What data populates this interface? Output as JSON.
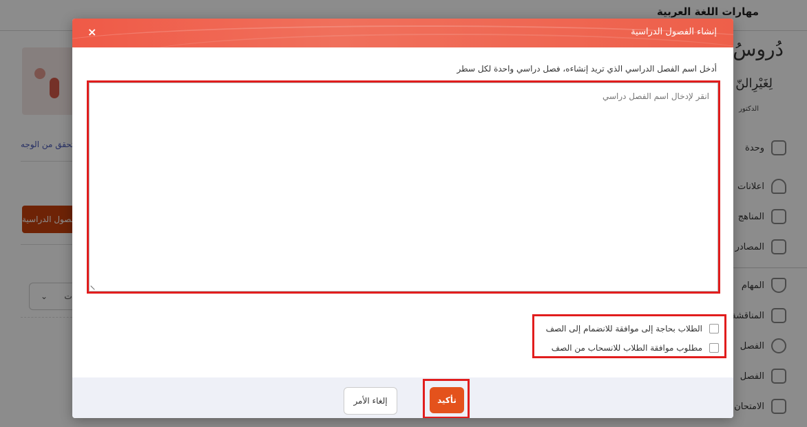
{
  "background": {
    "course_title": "مهارات اللغة العربية",
    "logo_script": "دُروسُ اللُّ",
    "logo_sub": "لِغَيْرِالنّ",
    "logo_author": "الدكتور",
    "sidebar": [
      {
        "label": "وحدة",
        "icon": "list-icon"
      },
      {
        "label": "اعلانات",
        "icon": "bell-icon"
      },
      {
        "label": "المناهج",
        "icon": "book-icon"
      },
      {
        "label": "المصادر",
        "icon": "database-icon"
      },
      {
        "label": "المهام",
        "icon": "shield-icon"
      },
      {
        "label": "المناقشة",
        "icon": "chat-icon"
      },
      {
        "label": "الفصل",
        "icon": "user-icon"
      },
      {
        "label": "الفصل",
        "icon": "video-icon"
      },
      {
        "label": "الامتحان",
        "icon": "clipboard-icon"
      }
    ],
    "face_link": "التحقق من الوجه",
    "orange_button": "الفصول الدراسية",
    "select_text": "ات"
  },
  "modal": {
    "title": "إنشاء الفصول الدراسية",
    "close_label": "×",
    "instruction": "أدخل اسم الفصل الدراسي الذي تريد إنشاءه، فصل دراسي واحدة لكل سطر",
    "textarea_placeholder": "انقر لإدخال اسم الفصل دراسي",
    "checkboxes": [
      {
        "label": "الطلاب بحاجة إلى موافقة للانضمام إلى الصف",
        "checked": false
      },
      {
        "label": "مطلوب موافقة الطلاب للانسحاب من الصف",
        "checked": false
      }
    ],
    "cancel_label": "إلغاء الأمر",
    "confirm_label": "تأكيد"
  },
  "colors": {
    "header": "#ef5a47",
    "confirm": "#e4521c",
    "highlight": "#e11d1d",
    "footer": "#eef0f7"
  }
}
